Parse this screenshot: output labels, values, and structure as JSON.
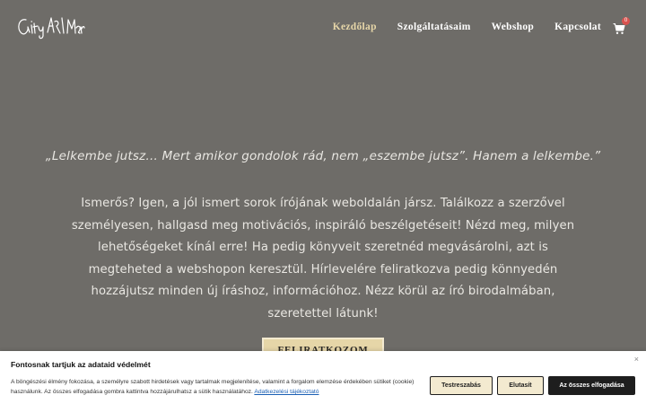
{
  "nav": {
    "items": [
      {
        "label": "Kezdőlap",
        "active": true
      },
      {
        "label": "Szolgáltatásaim",
        "active": false
      },
      {
        "label": "Webshop",
        "active": false
      },
      {
        "label": "Kapcsolat",
        "active": false
      }
    ],
    "cart_count": "0"
  },
  "hero": {
    "quote": "„Lelkembe jutsz… Mert amikor gondolok rád, nem „eszembe jutsz”. Hanem a lelkembe.”",
    "intro": "Ismerős? Igen, a jól ismert sorok írójának weboldalán jársz. Találkozz a szerzővel személyesen, hallgasd meg motivációs, inspiráló beszélgetéseit! Nézd meg, milyen lehetőségeket kínál erre! Ha pedig könyveit szeretnéd megvásárolni, azt is megteheted a webshopon keresztül. Hírlevelére feliratkozva pedig könnyedén hozzájutsz minden új íráshoz, információhoz. Nézz körül az író birodalmában, szeretettel látunk!",
    "button_label": "FELIRATKOZOM"
  },
  "cookie": {
    "title": "Fontosnak tartjuk az adataid védelmét",
    "text": "A böngészési élmény fokozása, a személyre szabott hirdetések vagy tartalmak megjelenítése, valamint a forgalom elemzése érdekében sütiket (cookie) használunk. Az összes elfogadása gombra kattintva hozzájárulhatsz a sütik használatához. ",
    "link": "Adatkezelési tájékoztató",
    "customize": "Testreszabás",
    "reject": "Elutasít",
    "accept": "Az összes elfogadása",
    "close": "×"
  },
  "colors": {
    "background": "#6e6c68",
    "accent": "#e6d6a8",
    "dark": "#1e1e1e"
  },
  "icons": {
    "logo": "signature-logo",
    "cart": "cart-icon"
  }
}
